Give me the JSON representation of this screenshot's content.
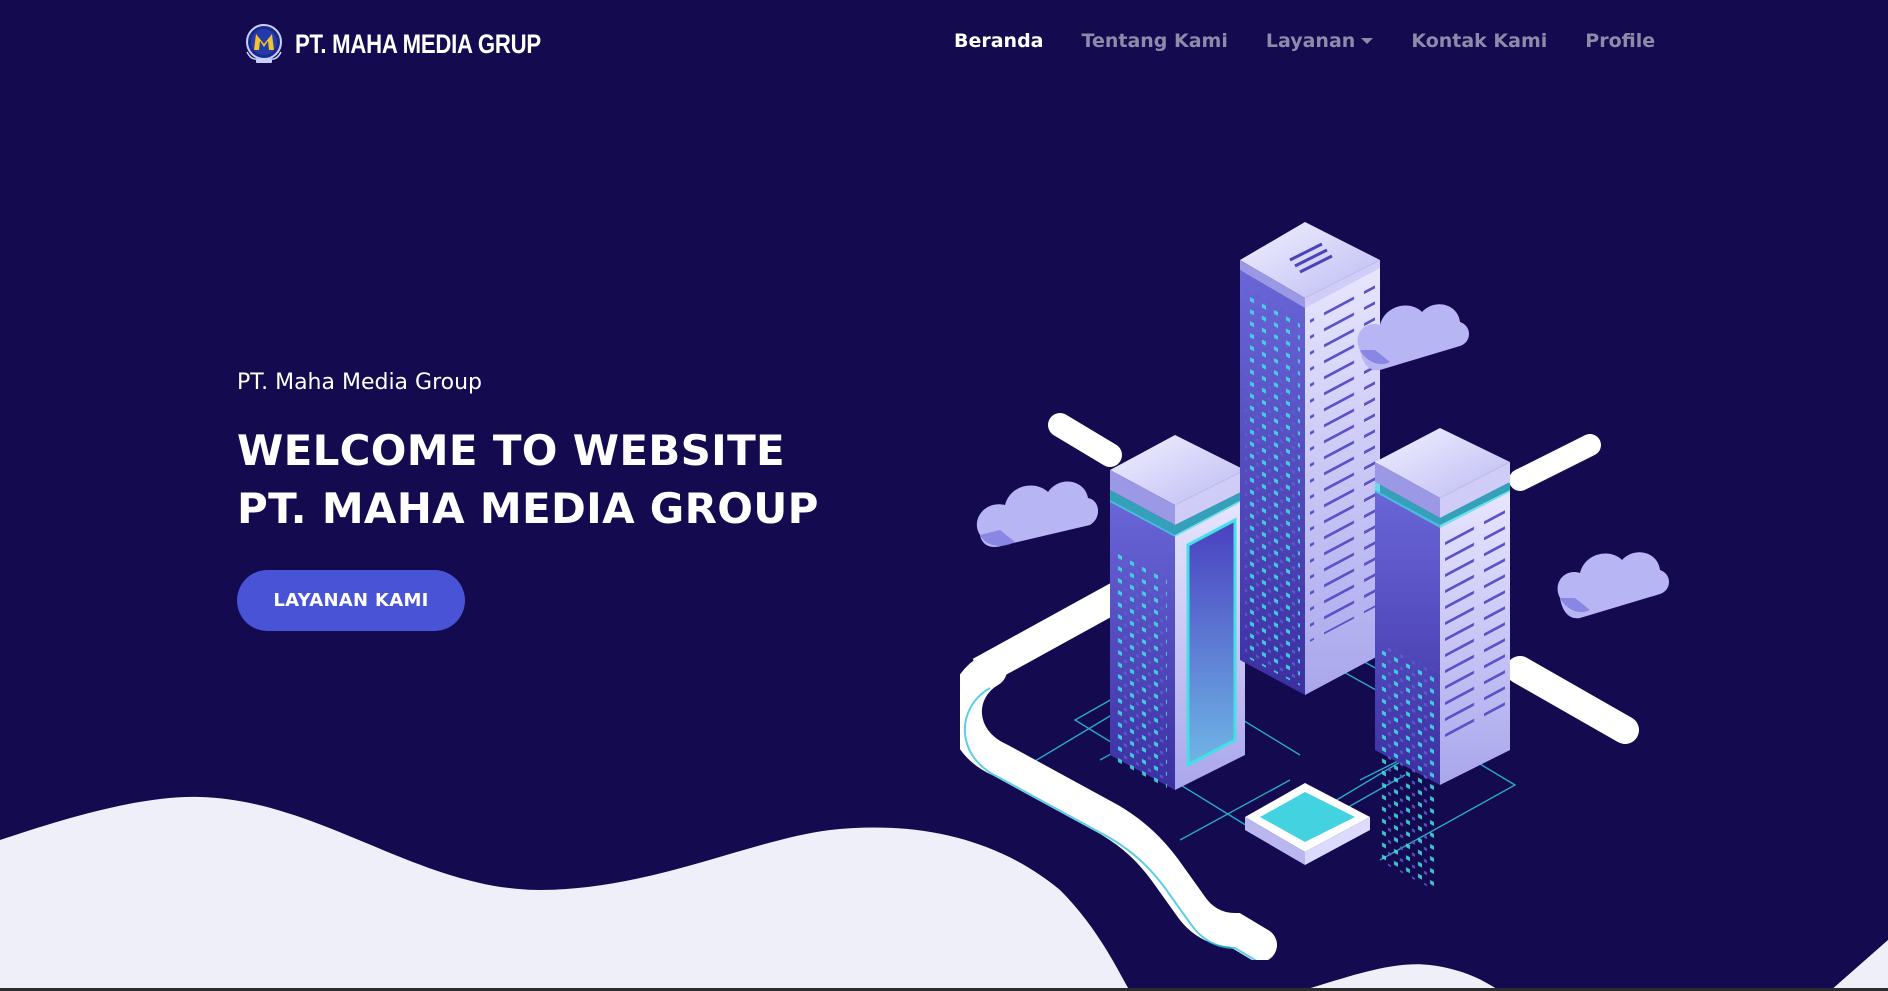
{
  "brand": {
    "logo_icon": "maha-media-logo-icon",
    "name": "PT. MAHA MEDIA GRUP"
  },
  "nav": {
    "items": [
      {
        "label": "Beranda",
        "active": true
      },
      {
        "label": "Tentang Kami",
        "active": false
      },
      {
        "label": "Layanan",
        "active": false,
        "dropdown": true
      },
      {
        "label": "Kontak Kami",
        "active": false
      },
      {
        "label": "Profile",
        "active": false
      }
    ]
  },
  "hero": {
    "subtitle": "PT. Maha Media Group",
    "title_line1": "WELCOME TO WEBSITE",
    "title_line2": "PT. MAHA MEDIA GROUP",
    "button_label": "LAYANAN KAMI",
    "illustration_icon": "isometric-city-servers-illustration"
  },
  "colors": {
    "background": "#130a50",
    "accent": "#4953d6",
    "wave": "#efeffa",
    "nav_inactive": "#8e8aa9"
  }
}
